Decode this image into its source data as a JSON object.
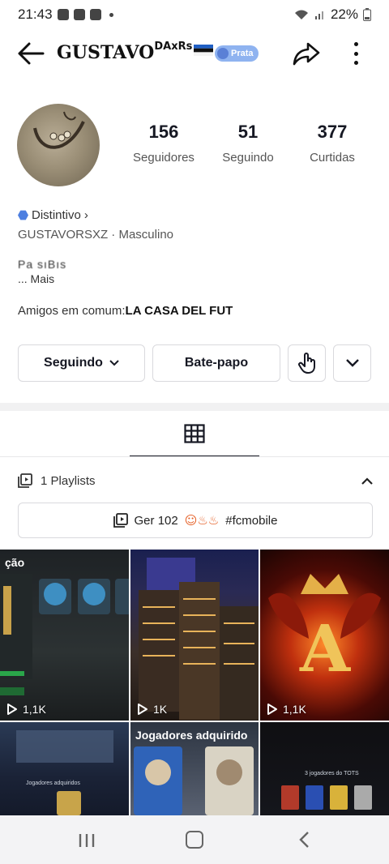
{
  "status_bar": {
    "time": "21:43",
    "battery": "22%"
  },
  "header": {
    "username": "GUSTAVO",
    "username_suffix": "DAxRs",
    "tier_badge": "Prata",
    "icons": [
      "back-arrow-icon",
      "share-icon",
      "more-vertical-icon"
    ]
  },
  "profile": {
    "stats": [
      {
        "value": "156",
        "label": "Seguidores"
      },
      {
        "value": "51",
        "label": "Seguindo"
      },
      {
        "value": "377",
        "label": "Curtidas"
      }
    ],
    "badge_label": "Distintivo",
    "handle": "GUSTAVORSXZ",
    "gender": "Masculino",
    "bio_line": "Pa sıBıs",
    "bio_more": "... Mais",
    "mutual_prefix": "Amigos em comum:",
    "mutual_name": "LA CASA DEL FUT"
  },
  "actions": {
    "following_label": "Seguindo",
    "chat_label": "Bate-papo"
  },
  "playlists": {
    "header": "1 Playlists",
    "chip_label": "Ger 102",
    "chip_tag": "#fcmobile"
  },
  "videos": [
    {
      "views": "1,1K",
      "caption": "ção"
    },
    {
      "views": "1K",
      "caption": ""
    },
    {
      "views": "1,1K",
      "caption": ""
    },
    {
      "caption": "",
      "small_text": "Jogadores adquiridos"
    },
    {
      "caption": "Jogadores adquirido"
    },
    {
      "caption": "",
      "small_text": "3 jogadores do TOTS"
    }
  ],
  "colors": {
    "accent_blue": "#4d7fe0",
    "badge_blue": "#8fb3f0",
    "text_primary": "#161823"
  }
}
